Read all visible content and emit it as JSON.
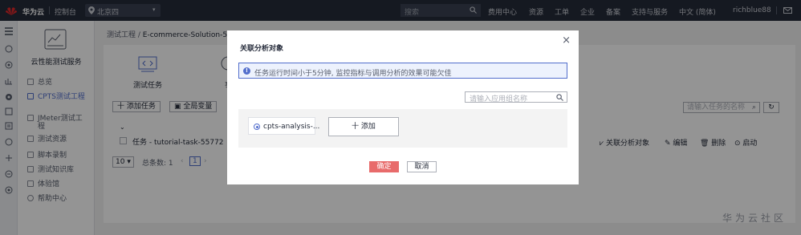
{
  "topbar": {
    "brand": "华为云",
    "console": "控制台",
    "region": "北京四",
    "search_placeholder": "搜索",
    "links": [
      "费用中心",
      "资源",
      "工单",
      "企业",
      "备案",
      "支持与服务",
      "中文 (简体)",
      "richblue88"
    ]
  },
  "sidenav": {
    "service_title": "云性能测试服务",
    "items": [
      {
        "label": "总览"
      },
      {
        "label": "CPTS测试工程"
      },
      {
        "label": "JMeter测试工程"
      },
      {
        "label": "测试资源"
      },
      {
        "label": "脚本录制"
      },
      {
        "label": "测试知识库"
      },
      {
        "label": "体验馆"
      },
      {
        "label": "帮助中心"
      }
    ]
  },
  "main": {
    "breadcrumb_parent": "测试工程",
    "breadcrumb_current": "E-commerce-Solution-55772",
    "tab_tasks": "测试任务",
    "tab_other": "事",
    "btn_add_task": "十 添加任务",
    "btn_global_vars": "全局变量",
    "task_search_placeholder": "请输入任务的名称",
    "task_row": "任务 - tutorial-task-55772",
    "row_actions": [
      "关联分析对象",
      "编辑",
      "删除",
      "启动"
    ],
    "page_size": "10",
    "total": "总条数: 1",
    "current_page": "1"
  },
  "modal": {
    "title": "关联分析对象",
    "alert": "任务运行时间小于5分钟, 监控指标与调用分析的效果可能欠佳",
    "search_placeholder": "请输入应用组名称",
    "selected_item": "cpts-analysis-...",
    "add_button": "十 添加",
    "confirm": "确定",
    "cancel": "取消",
    "close": "×"
  },
  "watermark": "华为云社区",
  "colors": {
    "topbar": "#252b3a",
    "accent": "#526ecc",
    "danger": "#e86b6b"
  }
}
